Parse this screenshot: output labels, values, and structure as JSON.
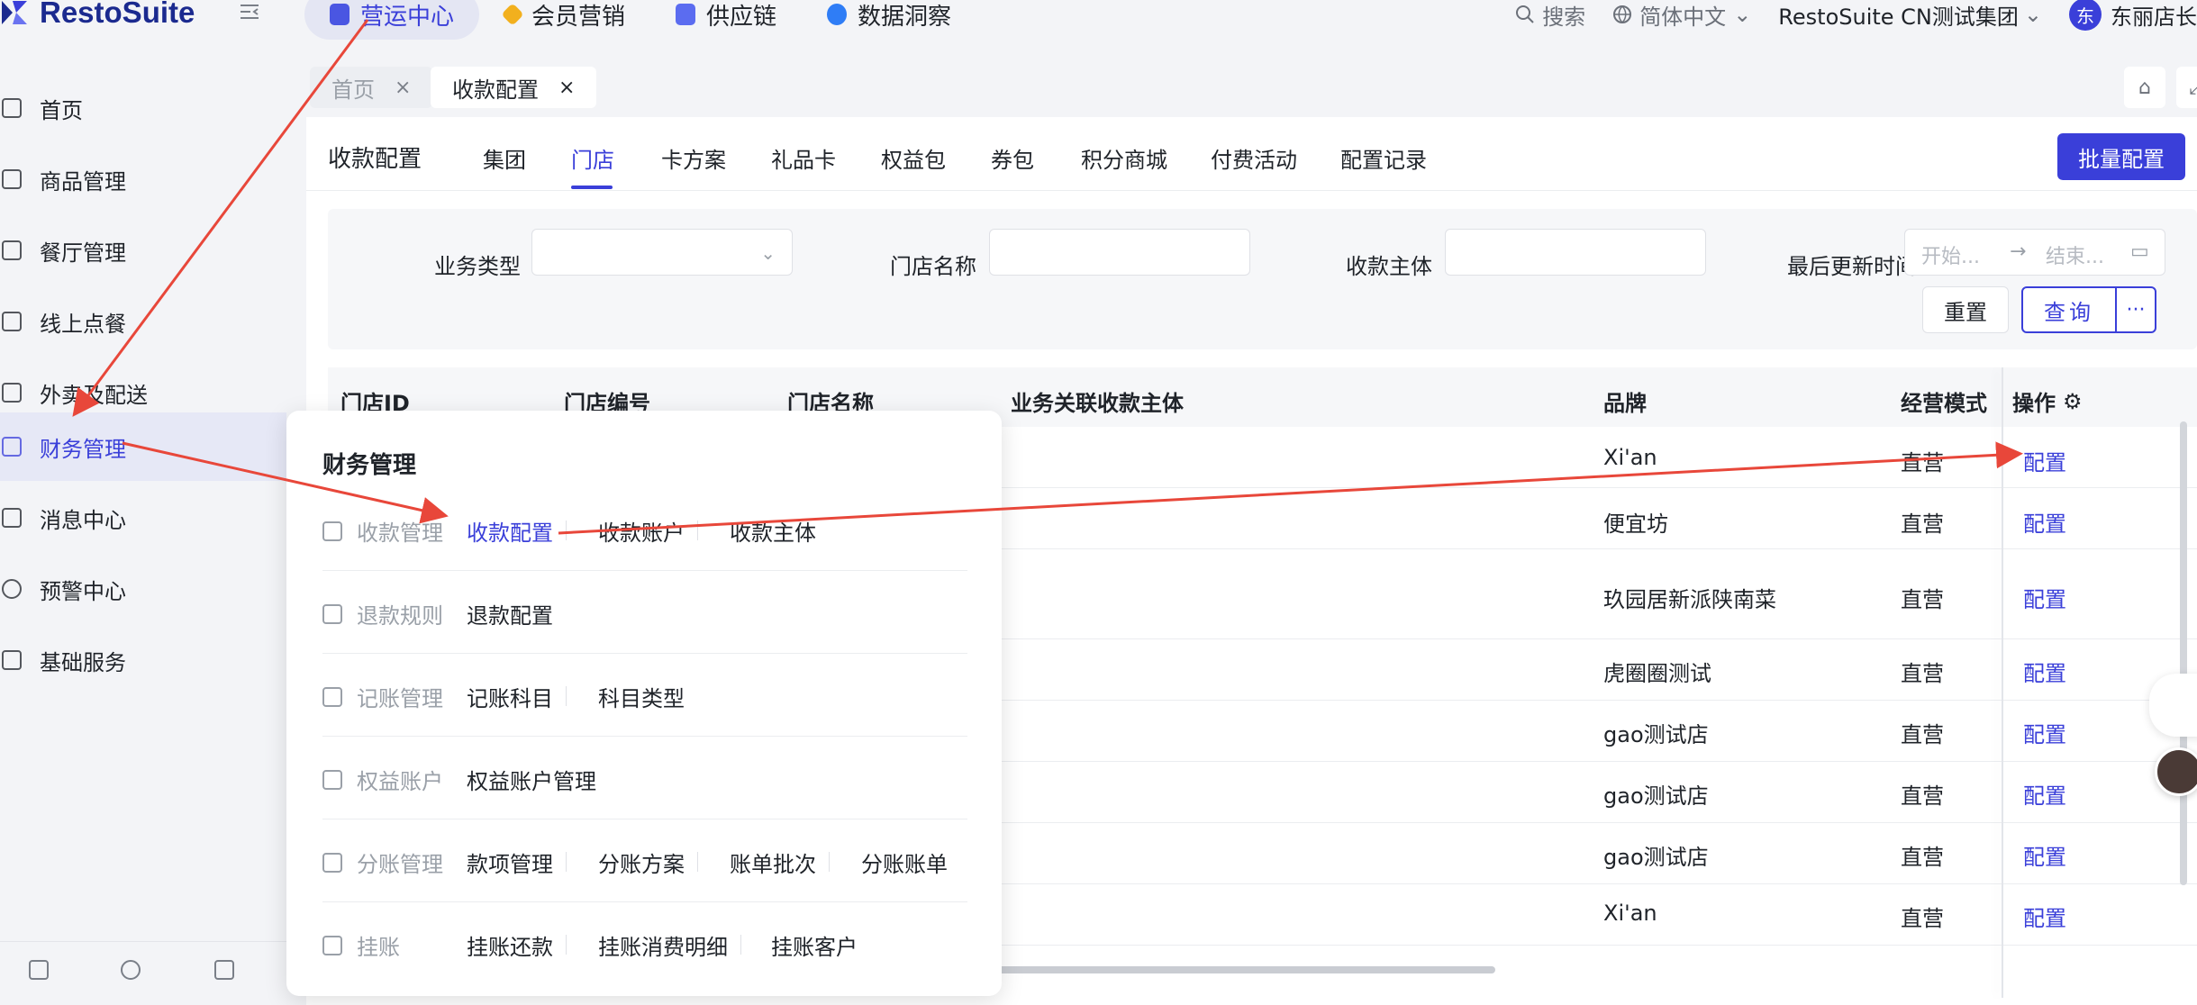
{
  "app": {
    "name": "RestoSuite"
  },
  "topnav": [
    {
      "label": "营运中心",
      "active": true,
      "icon": "store-icon",
      "color": "#4a56e2"
    },
    {
      "label": "会员营销",
      "active": false,
      "icon": "diamond-icon",
      "color": "#f2b01e"
    },
    {
      "label": "供应链",
      "active": false,
      "icon": "box-icon",
      "color": "#5b6cf0"
    },
    {
      "label": "数据洞察",
      "active": false,
      "icon": "chart-icon",
      "color": "#2f7df6"
    }
  ],
  "topright": {
    "search": "搜索",
    "language": "简体中文",
    "org": "RestoSuite CN测试集团",
    "user_initial": "东",
    "user": "东丽店长"
  },
  "sidebar": {
    "items": [
      {
        "label": "首页",
        "icon": "home-icon"
      },
      {
        "label": "商品管理",
        "icon": "cube-icon"
      },
      {
        "label": "餐厅管理",
        "icon": "shop-icon"
      },
      {
        "label": "线上点餐",
        "icon": "hand-tap-icon"
      },
      {
        "label": "外卖及配送",
        "icon": "bag-icon"
      },
      {
        "label": "财务管理",
        "icon": "wallet-icon",
        "active": true
      },
      {
        "label": "消息中心",
        "icon": "mail-icon"
      },
      {
        "label": "预警中心",
        "icon": "bulb-icon"
      },
      {
        "label": "基础服务",
        "icon": "grid-icon"
      }
    ]
  },
  "tabs": {
    "home": "首页",
    "current": "收款配置"
  },
  "page": {
    "title": "收款配置",
    "subtabs": [
      "集团",
      "门店",
      "卡方案",
      "礼品卡",
      "权益包",
      "券包",
      "积分商城",
      "付费活动",
      "配置记录"
    ],
    "active_subtab": "门店",
    "batch_button": "批量配置"
  },
  "filters": {
    "business_type_label": "业务类型",
    "store_name_label": "门店名称",
    "payee_label": "收款主体",
    "updated_label": "最后更新时间",
    "date_start_placeholder": "开始...",
    "date_end_placeholder": "结束...",
    "reset": "重置",
    "query": "查询",
    "more": "···"
  },
  "table": {
    "columns": [
      "门店ID",
      "门店编号",
      "门店名称",
      "业务关联收款主体",
      "品牌",
      "经营模式",
      "操作"
    ],
    "rows": [
      {
        "brand": "Xi'an",
        "mode": "直营",
        "action": "配置"
      },
      {
        "brand": "便宜坊",
        "mode": "直营",
        "action": "配置"
      },
      {
        "brand": "玖园居新派陕南菜",
        "mode": "直营",
        "action": "配置"
      },
      {
        "brand": "虎圈圈测试",
        "mode": "直营",
        "action": "配置"
      },
      {
        "brand": "gao测试店",
        "mode": "直营",
        "action": "配置"
      },
      {
        "brand": "gao测试店",
        "mode": "直营",
        "action": "配置"
      },
      {
        "brand": "gao测试店",
        "mode": "直营",
        "action": "配置"
      },
      {
        "brand": "Xi'an",
        "mode": "直营",
        "action": "配置"
      }
    ]
  },
  "mega_menu": {
    "title": "财务管理",
    "groups": [
      {
        "category": "收款管理",
        "icon": "cashier-icon",
        "links": [
          "收款配置",
          "收款账户",
          "收款主体"
        ],
        "active_link": "收款配置"
      },
      {
        "category": "退款规则",
        "icon": "refund-icon",
        "links": [
          "退款配置"
        ]
      },
      {
        "category": "记账管理",
        "icon": "clipboard-icon",
        "links": [
          "记账科目",
          "科目类型"
        ]
      },
      {
        "category": "权益账户",
        "icon": "id-card-icon",
        "links": [
          "权益账户管理"
        ]
      },
      {
        "category": "分账管理",
        "icon": "split-icon",
        "links": [
          "款项管理",
          "分账方案",
          "账单批次",
          "分账账单"
        ]
      },
      {
        "category": "挂账",
        "icon": "credit-icon",
        "links": [
          "挂账还款",
          "挂账消费明细",
          "挂账客户"
        ]
      }
    ]
  },
  "colors": {
    "accent": "#3a3fd9",
    "annotation_arrow": "#e8473a"
  }
}
